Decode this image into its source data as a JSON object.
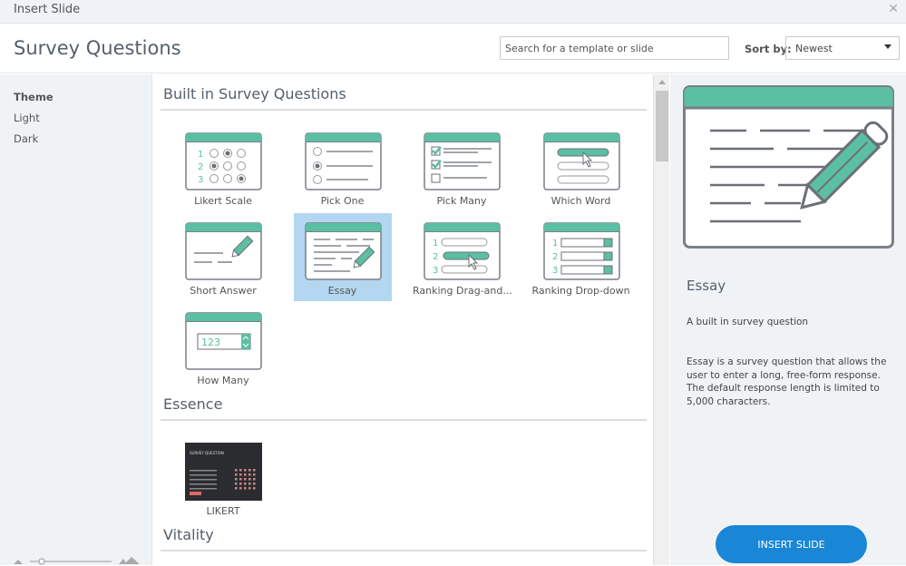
{
  "window": {
    "title": "Insert Slide",
    "close_icon": "close-icon"
  },
  "header": {
    "title": "Survey Questions",
    "search_placeholder": "Search for a template or slide",
    "sort_label": "Sort by:",
    "sort_value": "Newest"
  },
  "sidebar": {
    "heading": "Theme",
    "items": [
      {
        "label": "Light"
      },
      {
        "label": "Dark"
      }
    ]
  },
  "sections": [
    {
      "title": "Built in Survey Questions",
      "items": [
        {
          "label": "Likert Scale",
          "kind": "likert"
        },
        {
          "label": "Pick One",
          "kind": "pickone"
        },
        {
          "label": "Pick Many",
          "kind": "pickmany"
        },
        {
          "label": "Which Word",
          "kind": "whichword"
        },
        {
          "label": "Short Answer",
          "kind": "short"
        },
        {
          "label": "Essay",
          "kind": "essay",
          "selected": true
        },
        {
          "label": "Ranking  Drag-and...",
          "kind": "rankdrag"
        },
        {
          "label": "Ranking Drop-down",
          "kind": "rankdrop"
        },
        {
          "label": "How Many",
          "kind": "howmany",
          "value": "123"
        }
      ]
    },
    {
      "title": "Essence",
      "items": [
        {
          "label": "LIKERT",
          "kind": "dark",
          "thumb_text": "SURVEY QUESTION"
        }
      ]
    },
    {
      "title": "Vitality",
      "items": []
    }
  ],
  "details": {
    "name": "Essay",
    "subtitle": "A built in survey question",
    "description": "Essay is a survey question that allows the user to enter a long, free-form response. The default response length is limited to 5,000 characters.",
    "insert_label": "INSERT SLIDE"
  },
  "colors": {
    "accent": "#5bbfa3",
    "button": "#1a86d6",
    "selected": "#b3d7f0"
  }
}
